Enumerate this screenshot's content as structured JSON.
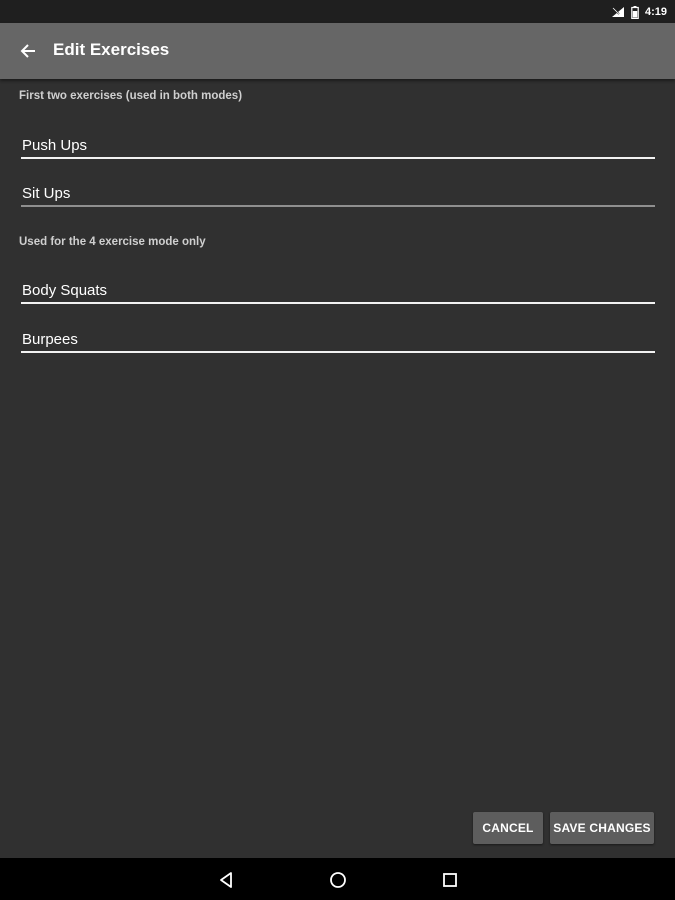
{
  "status_bar": {
    "time": "4:19",
    "icons": [
      "signal-icon",
      "battery-icon"
    ]
  },
  "app_bar": {
    "title": "Edit Exercises",
    "back_icon": "back-arrow-icon"
  },
  "sections": [
    {
      "label": "First two exercises (used in both modes)",
      "fields": [
        {
          "value": "Push Ups"
        },
        {
          "value": "Sit Ups"
        }
      ]
    },
    {
      "label": "Used for the 4 exercise mode only",
      "fields": [
        {
          "value": "Body Squats"
        },
        {
          "value": "Burpees"
        }
      ]
    }
  ],
  "actions": {
    "cancel_label": "CANCEL",
    "save_label": "SAVE CHANGES"
  },
  "nav_bar": {
    "icons": [
      "back-triangle-icon",
      "home-circle-icon",
      "recents-square-icon"
    ]
  },
  "colors": {
    "background": "#303030",
    "app_bar": "#666666",
    "button": "#5d5d5d",
    "status_bar": "#1f1f1f",
    "nav_bar": "#000000"
  }
}
